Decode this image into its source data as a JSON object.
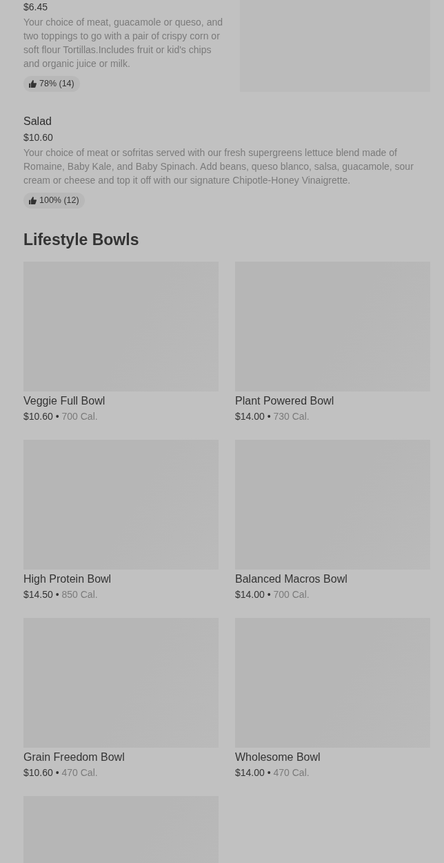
{
  "items": [
    {
      "price": "$6.45",
      "description": "Your choice of meat, guacamole or queso, and two toppings to go with a pair of crispy corn or soft flour Tortillas.Includes fruit or kid's chips and organic juice or milk.",
      "rating": "78% (14)",
      "has_image": true
    },
    {
      "name": "Salad",
      "price": "$10.60",
      "description": "Your choice of meat or sofritas served with our fresh supergreens lettuce blend made of Romaine, Baby Kale, and Baby Spinach. Add beans, queso blanco, salsa, guacamole, sour cream or cheese and top it off with our signature Chipotle-Honey Vinaigrette.",
      "rating": "100% (12)",
      "has_image": false
    }
  ],
  "section": {
    "title": "Lifestyle Bowls",
    "cards": [
      {
        "name": "Veggie Full Bowl",
        "price": "$10.60",
        "separator": "•",
        "calories": "700 Cal."
      },
      {
        "name": "Plant Powered Bowl",
        "price": "$14.00",
        "separator": "•",
        "calories": "730 Cal."
      },
      {
        "name": "High Protein Bowl",
        "price": "$14.50",
        "separator": "•",
        "calories": "850 Cal."
      },
      {
        "name": "Balanced Macros Bowl",
        "price": "$14.00",
        "separator": "•",
        "calories": "700 Cal."
      },
      {
        "name": "Grain Freedom Bowl",
        "price": "$10.60",
        "separator": "•",
        "calories": "470 Cal."
      },
      {
        "name": "Wholesome Bowl",
        "price": "$14.00",
        "separator": "•",
        "calories": "470 Cal."
      }
    ],
    "trailing_tile": true
  }
}
